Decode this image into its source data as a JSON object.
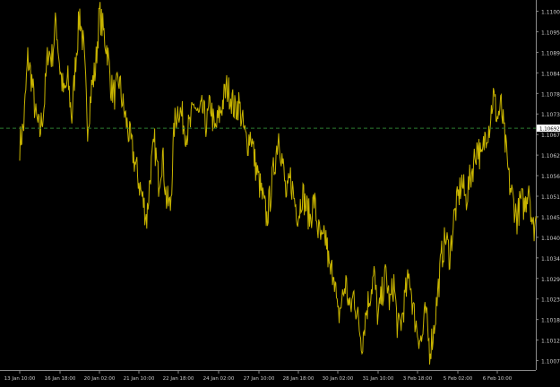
{
  "chart_data": {
    "type": "line",
    "colors": {
      "background": "#000000",
      "price": "#c8b400",
      "axis": "#8a8a8a",
      "text": "#c8c8c8",
      "current_line": "#2e7d32",
      "current_box_bg": "#ffffff",
      "current_box_text": "#000000"
    },
    "ylim": [
      1.10045,
      1.11035
    ],
    "y_ticks": [
      {
        "value": 1.11005,
        "label": "1.11005"
      },
      {
        "value": 1.1095,
        "label": "1.10950"
      },
      {
        "value": 1.10895,
        "label": "1.10895"
      },
      {
        "value": 1.1084,
        "label": "1.10840"
      },
      {
        "value": 1.10785,
        "label": "1.10785"
      },
      {
        "value": 1.1073,
        "label": "1.10730"
      },
      {
        "value": 1.10675,
        "label": "1.10675"
      },
      {
        "value": 1.1062,
        "label": "1.10620"
      },
      {
        "value": 1.10565,
        "label": "1.10565"
      },
      {
        "value": 1.1051,
        "label": "1.10510"
      },
      {
        "value": 1.10455,
        "label": "1.10455"
      },
      {
        "value": 1.104,
        "label": "1.10400"
      },
      {
        "value": 1.10345,
        "label": "1.10345"
      },
      {
        "value": 1.1029,
        "label": "1.10290"
      },
      {
        "value": 1.10235,
        "label": "1.10235"
      },
      {
        "value": 1.1018,
        "label": "1.10180"
      },
      {
        "value": 1.10125,
        "label": "1.10125"
      },
      {
        "value": 1.1007,
        "label": "1.10070"
      }
    ],
    "current_price": {
      "value": 1.10692,
      "label": "1.10692"
    },
    "x_ticks": [
      {
        "index": 0,
        "label": "13 Jan 10:00"
      },
      {
        "index": 1,
        "label": "16 Jan 18:00"
      },
      {
        "index": 2,
        "label": "20 Jan 02:00"
      },
      {
        "index": 3,
        "label": "21 Jan 10:00"
      },
      {
        "index": 4,
        "label": "22 Jan 18:00"
      },
      {
        "index": 5,
        "label": "24 Jan 02:00"
      },
      {
        "index": 6,
        "label": "27 Jan 10:00"
      },
      {
        "index": 7,
        "label": "28 Jan 18:00"
      },
      {
        "index": 8,
        "label": "30 Jan 02:00"
      },
      {
        "index": 9,
        "label": "31 Jan 10:00"
      },
      {
        "index": 10,
        "label": "3 Feb 18:00"
      },
      {
        "index": 11,
        "label": "5 Feb 02:00"
      },
      {
        "index": 12,
        "label": "6 Feb 10:00"
      }
    ],
    "x_range": [
      0,
      13.2
    ],
    "series": [
      {
        "x": [
          0.0,
          0.1,
          0.2,
          0.3,
          0.4,
          0.5,
          0.6,
          0.7,
          0.8,
          0.9,
          1.0,
          1.1,
          1.2,
          1.3,
          1.4,
          1.5,
          1.6,
          1.7,
          1.8,
          1.9,
          2.0,
          2.1,
          2.2,
          2.3,
          2.4,
          2.5,
          2.6,
          2.7,
          2.8,
          2.9,
          3.0,
          3.1,
          3.2,
          3.3,
          3.4,
          3.5,
          3.6,
          3.7,
          3.8,
          3.9,
          4.0,
          4.1,
          4.2,
          4.3,
          4.4,
          4.5,
          4.6,
          4.7,
          4.8,
          4.9,
          5.0,
          5.1,
          5.2,
          5.3,
          5.4,
          5.5,
          5.6,
          5.7,
          5.8,
          5.9,
          6.0,
          6.1,
          6.2,
          6.3,
          6.4,
          6.5,
          6.6,
          6.7,
          6.8,
          6.9,
          7.0,
          7.1,
          7.2,
          7.3,
          7.4,
          7.5,
          7.6,
          7.7,
          7.8,
          7.9,
          8.0,
          8.1,
          8.2,
          8.3,
          8.4,
          8.5,
          8.6,
          8.7,
          8.8,
          8.9,
          9.0,
          9.1,
          9.2,
          9.3,
          9.4,
          9.5,
          9.6,
          9.7,
          9.8,
          9.9,
          10.0,
          10.1,
          10.2,
          10.3,
          10.4,
          10.5,
          10.6,
          10.7,
          10.8,
          10.9,
          11.0,
          11.1,
          11.2,
          11.3,
          11.4,
          11.5,
          11.6,
          11.7,
          11.8,
          11.9,
          12.0,
          12.1,
          12.2,
          12.3,
          12.4,
          12.5,
          12.6,
          12.7,
          12.8,
          12.9,
          13.0
        ],
        "y": [
          1.1065,
          1.107,
          1.1088,
          1.1082,
          1.1072,
          1.1068,
          1.1075,
          1.109,
          1.1088,
          1.1098,
          1.1085,
          1.1078,
          1.1082,
          1.1072,
          1.1088,
          1.11,
          1.109,
          1.107,
          1.108,
          1.1085,
          1.11,
          1.1095,
          1.109,
          1.108,
          1.1078,
          1.1082,
          1.1075,
          1.107,
          1.1065,
          1.106,
          1.1055,
          1.105,
          1.1045,
          1.1058,
          1.1065,
          1.1055,
          1.1062,
          1.105,
          1.1048,
          1.107,
          1.1075,
          1.1072,
          1.1068,
          1.107,
          1.1076,
          1.1072,
          1.1074,
          1.107,
          1.1076,
          1.1068,
          1.1072,
          1.1076,
          1.108,
          1.1078,
          1.1074,
          1.1076,
          1.107,
          1.1065,
          1.1068,
          1.106,
          1.1055,
          1.105,
          1.1045,
          1.1052,
          1.106,
          1.1068,
          1.106,
          1.105,
          1.1056,
          1.105,
          1.1046,
          1.1052,
          1.1048,
          1.1045,
          1.105,
          1.1042,
          1.1038,
          1.104,
          1.103,
          1.1032,
          1.1018,
          1.1023,
          1.1028,
          1.102,
          1.1025,
          1.1018,
          1.1012,
          1.102,
          1.1025,
          1.103,
          1.1018,
          1.1025,
          1.103,
          1.1022,
          1.1028,
          1.1015,
          1.1018,
          1.1025,
          1.103,
          1.102,
          1.1015,
          1.1012,
          1.102,
          1.101,
          1.1015,
          1.1025,
          1.1035,
          1.104,
          1.1035,
          1.1045,
          1.105,
          1.1055,
          1.105,
          1.1055,
          1.106,
          1.1065,
          1.106,
          1.1068,
          1.107,
          1.1078,
          1.1072,
          1.1075,
          1.1065,
          1.1055,
          1.105,
          1.1045,
          1.105,
          1.1048,
          1.1055,
          1.1042,
          1.1045
        ]
      }
    ]
  }
}
